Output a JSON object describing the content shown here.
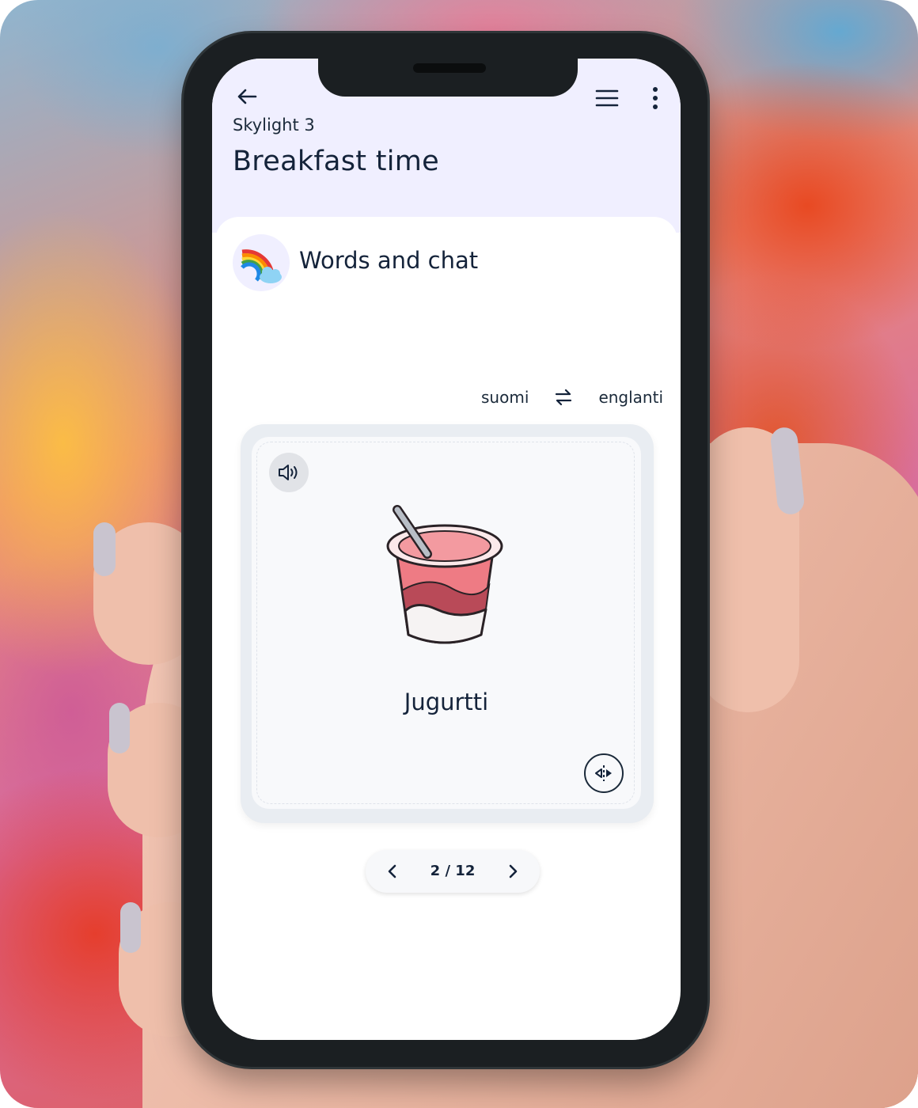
{
  "header": {
    "subtitle": "Skylight 3",
    "title": "Breakfast time"
  },
  "section": {
    "title": "Words and chat",
    "icon": "rainbow-icon"
  },
  "language": {
    "from": "suomi",
    "to": "englanti",
    "swap_icon": "swap-arrows-icon"
  },
  "card": {
    "word": "Jugurtti",
    "image": "yogurt-cup-illustration",
    "sound_icon": "speaker-icon",
    "flip_icon": "flip-icon"
  },
  "pager": {
    "label": "2 / 12",
    "current": 2,
    "total": 12
  },
  "colors": {
    "header_bg": "#f0efff",
    "text": "#14233a",
    "card_bg": "#f8f9fb"
  }
}
